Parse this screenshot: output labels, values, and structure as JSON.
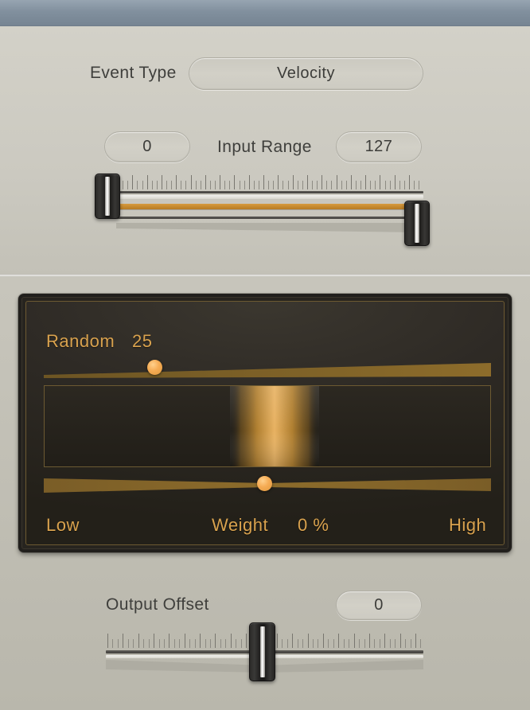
{
  "window": {
    "title": ""
  },
  "event_type": {
    "label": "Event Type",
    "value": "Velocity"
  },
  "input_range": {
    "label": "Input Range",
    "min_value": "0",
    "max_value": "127"
  },
  "random_panel": {
    "random_label": "Random",
    "random_value": "25",
    "low_label": "Low",
    "weight_label": "Weight",
    "weight_value": "0 %",
    "high_label": "High"
  },
  "output_offset": {
    "label": "Output Offset",
    "value": "0"
  },
  "colors": {
    "titlebar": "#7f8e9c",
    "panel_bg": "#cbc9c0",
    "dark_panel": "#27241f",
    "accent_gold": "#d9a24e",
    "accent_amber": "#c8862c",
    "knob": "#f5ab53",
    "text_dark": "#3f3f3c"
  },
  "chart_data": {
    "type": "area",
    "title": "Random distribution",
    "xlabel": "Weight",
    "ylabel": "",
    "x_axis_low_label": "Low",
    "x_axis_high_label": "High",
    "weight_percent": 0,
    "random_amount": 25,
    "band_center_pct": 50,
    "band_width_pct": 16,
    "grid": false,
    "legend": "none"
  }
}
